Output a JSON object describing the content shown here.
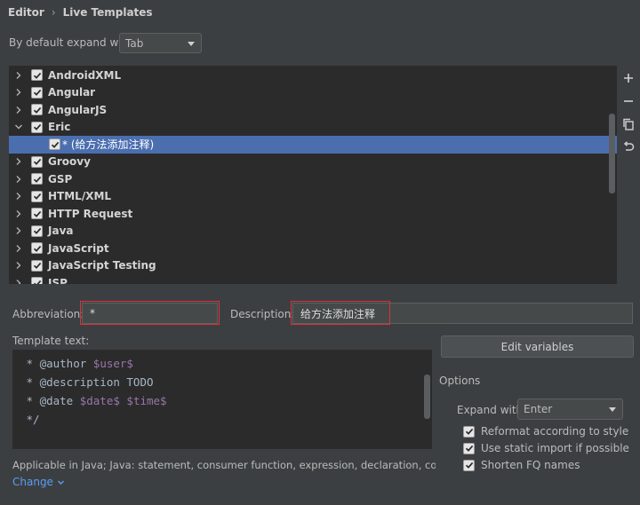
{
  "breadcrumb": {
    "parent": "Editor",
    "separator": "›",
    "current": "Live Templates"
  },
  "expand": {
    "label": "By default expand with",
    "value": "Tab"
  },
  "tree": {
    "rows": [
      {
        "label": "AndroidXML",
        "expanded": false,
        "checked": true,
        "child": false
      },
      {
        "label": "Angular",
        "expanded": false,
        "checked": true,
        "child": false
      },
      {
        "label": "AngularJS",
        "expanded": false,
        "checked": true,
        "child": false
      },
      {
        "label": "Eric",
        "expanded": true,
        "checked": true,
        "child": false
      },
      {
        "label": "* (给方法添加注释)",
        "expanded": false,
        "checked": true,
        "child": true,
        "selected": true
      },
      {
        "label": "Groovy",
        "expanded": false,
        "checked": true,
        "child": false
      },
      {
        "label": "GSP",
        "expanded": false,
        "checked": true,
        "child": false
      },
      {
        "label": "HTML/XML",
        "expanded": false,
        "checked": true,
        "child": false
      },
      {
        "label": "HTTP Request",
        "expanded": false,
        "checked": true,
        "child": false
      },
      {
        "label": "Java",
        "expanded": false,
        "checked": true,
        "child": false
      },
      {
        "label": "JavaScript",
        "expanded": false,
        "checked": true,
        "child": false
      },
      {
        "label": "JavaScript Testing",
        "expanded": false,
        "checked": true,
        "child": false
      },
      {
        "label": "JSP",
        "expanded": false,
        "checked": true,
        "child": false
      }
    ]
  },
  "toolbar": {
    "add": "plus-icon",
    "remove": "minus-icon",
    "copy": "copy-icon",
    "revert": "revert-icon"
  },
  "abbreviation": {
    "label": "Abbreviation:",
    "value": "*"
  },
  "description": {
    "label": "Description:",
    "value": "给方法添加注释"
  },
  "template": {
    "label": "Template text:",
    "lines": [
      [
        {
          "t": " * @author ",
          "v": false
        },
        {
          "t": "$user$",
          "v": true
        }
      ],
      [
        {
          "t": " * @description TODO",
          "v": false
        }
      ],
      [
        {
          "t": " * @date ",
          "v": false
        },
        {
          "t": "$date$",
          "v": true
        },
        {
          "t": " ",
          "v": false
        },
        {
          "t": "$time$",
          "v": true
        }
      ],
      [
        {
          "t": " */",
          "v": false
        }
      ]
    ]
  },
  "edit_variables": "Edit variables",
  "options": {
    "title": "Options",
    "expand_label": "Expand with",
    "expand_value": "Enter",
    "reformat": "Reformat according to style",
    "static_import": "Use static import if possible",
    "shorten": "Shorten FQ names"
  },
  "applicable": {
    "text": "Applicable in Java; Java: statement, consumer function, expression, declaration, comment, ...",
    "change": "Change"
  },
  "colors": {
    "selection": "#4b6eaf",
    "highlight": "#e0303a",
    "link": "#589df6"
  }
}
